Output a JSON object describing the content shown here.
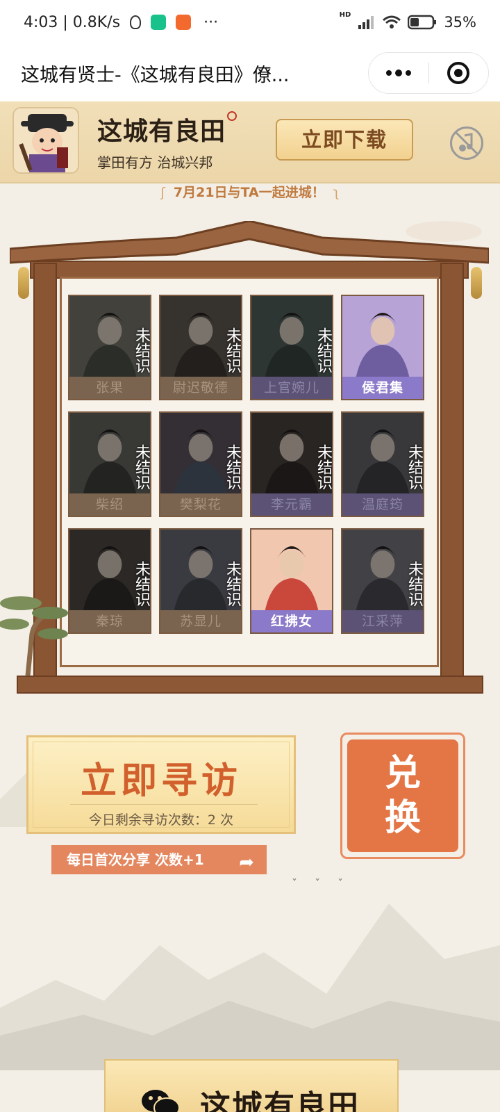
{
  "status_bar": {
    "time_speed": "4:03 | 0.8K/s",
    "more": "···",
    "net": "HD",
    "battery": "35%"
  },
  "nav": {
    "title": "这城有贤士-《这城有良田》僚..."
  },
  "banner": {
    "logo": "这城有良田",
    "slogan": "掌田有方 治城兴邦",
    "download_label": "立即下载"
  },
  "date_banner": "7月21日与TA一起进城！",
  "cards": [
    {
      "name": "张果",
      "hint": "未结识",
      "status": "locked"
    },
    {
      "name": "尉迟敬德",
      "hint": "未结识",
      "status": "locked"
    },
    {
      "name": "上官婉儿",
      "hint": "未结识",
      "status": "locked"
    },
    {
      "name": "侯君集",
      "hint": "",
      "status": "known"
    },
    {
      "name": "柴绍",
      "hint": "未结识",
      "status": "locked"
    },
    {
      "name": "樊梨花",
      "hint": "未结识",
      "status": "locked"
    },
    {
      "name": "李元霸",
      "hint": "未结识",
      "status": "locked"
    },
    {
      "name": "温庭筠",
      "hint": "未结识",
      "status": "locked"
    },
    {
      "name": "秦琼",
      "hint": "未结识",
      "status": "locked"
    },
    {
      "name": "苏显儿",
      "hint": "未结识",
      "status": "locked"
    },
    {
      "name": "红拂女",
      "hint": "",
      "status": "known"
    },
    {
      "name": "江采萍",
      "hint": "未结识",
      "status": "locked"
    }
  ],
  "visit": {
    "title": "立即寻访",
    "remaining": "今日剩余寻访次数：2 次"
  },
  "exchange": {
    "line1": "兑",
    "line2": "换"
  },
  "share": {
    "label": "每日首次分享 次数+1"
  },
  "footer": {
    "logo": "这城有良田"
  },
  "colors": {
    "accent_orange": "#e47545",
    "card_known": "#8b79c9",
    "frame_wood": "#8a5533"
  }
}
